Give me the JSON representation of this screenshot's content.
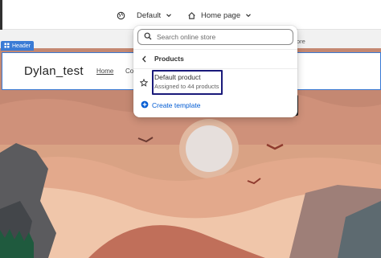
{
  "topbar": {
    "theme_label": "Default",
    "page_label": "Home page"
  },
  "preview": {
    "header_tag": "Header",
    "store_title": "Dylan_test",
    "nav": {
      "home": "Home",
      "partial": "Co"
    },
    "right_partial_text": "ore"
  },
  "dropdown": {
    "search_placeholder": "Search online store",
    "section_title": "Products",
    "templates": [
      {
        "name": "Default product",
        "subtitle": "Assigned to 44 products"
      }
    ],
    "create_label": "Create template"
  },
  "colors": {
    "accent_blue": "#3a7bd5",
    "link_blue": "#005bd3",
    "highlight_border": "#1a1a7a"
  }
}
